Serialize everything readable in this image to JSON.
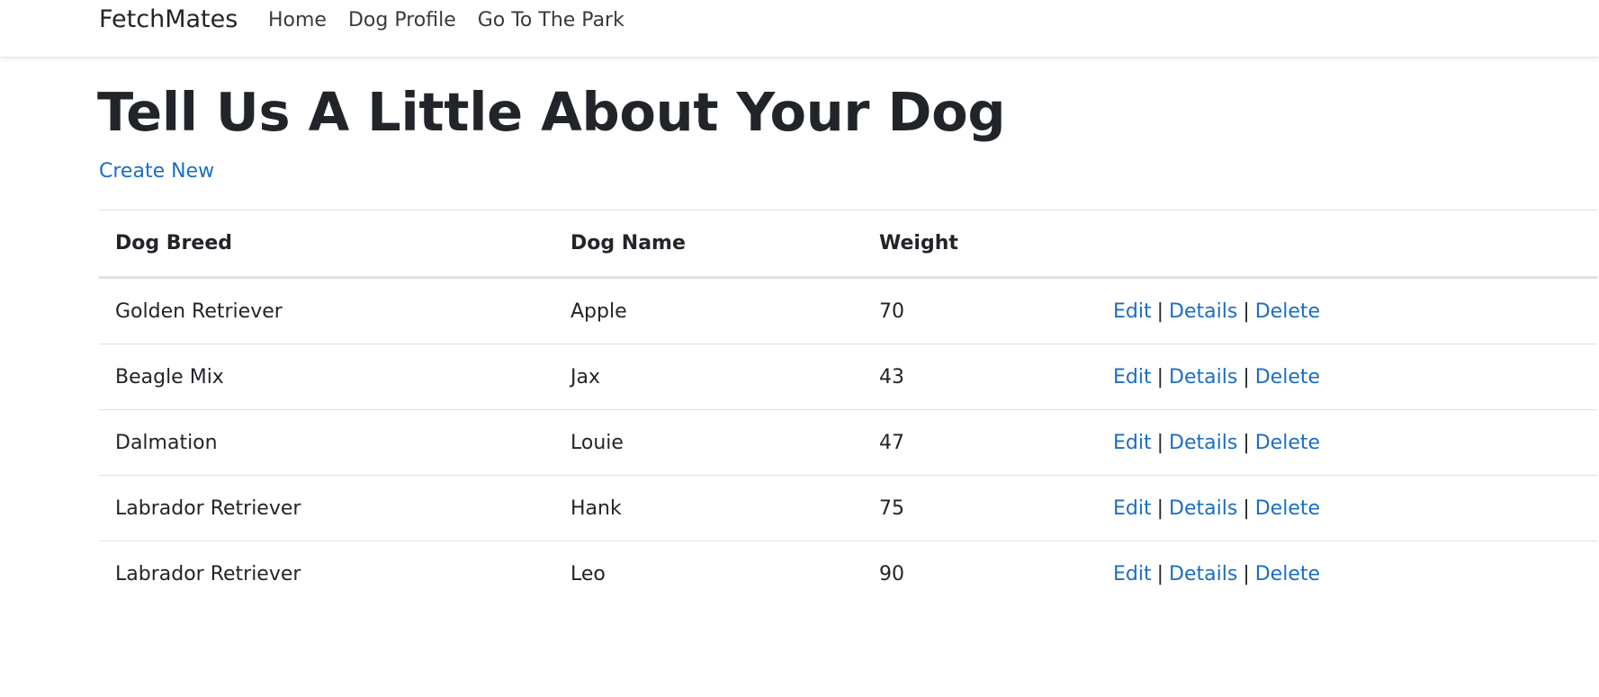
{
  "navbar": {
    "brand": "FetchMates",
    "links": [
      "Home",
      "Dog Profile",
      "Go To The Park"
    ]
  },
  "page": {
    "title": "Tell Us A Little About Your Dog",
    "create_new": "Create New"
  },
  "table": {
    "headers": [
      "Dog Breed",
      "Dog Name",
      "Weight",
      ""
    ],
    "rows": [
      {
        "breed": "Golden Retriever",
        "name": "Apple",
        "weight": "70"
      },
      {
        "breed": "Beagle Mix",
        "name": "Jax",
        "weight": "43"
      },
      {
        "breed": "Dalmation",
        "name": "Louie",
        "weight": "47"
      },
      {
        "breed": "Labrador Retriever",
        "name": "Hank",
        "weight": "75"
      },
      {
        "breed": "Labrador Retriever",
        "name": "Leo",
        "weight": "90"
      }
    ],
    "actions": {
      "edit": "Edit",
      "details": "Details",
      "delete": "Delete",
      "separator": "|"
    }
  },
  "colors": {
    "link": "#1b6ec2",
    "text": "#212529",
    "border": "#dee2e6"
  }
}
